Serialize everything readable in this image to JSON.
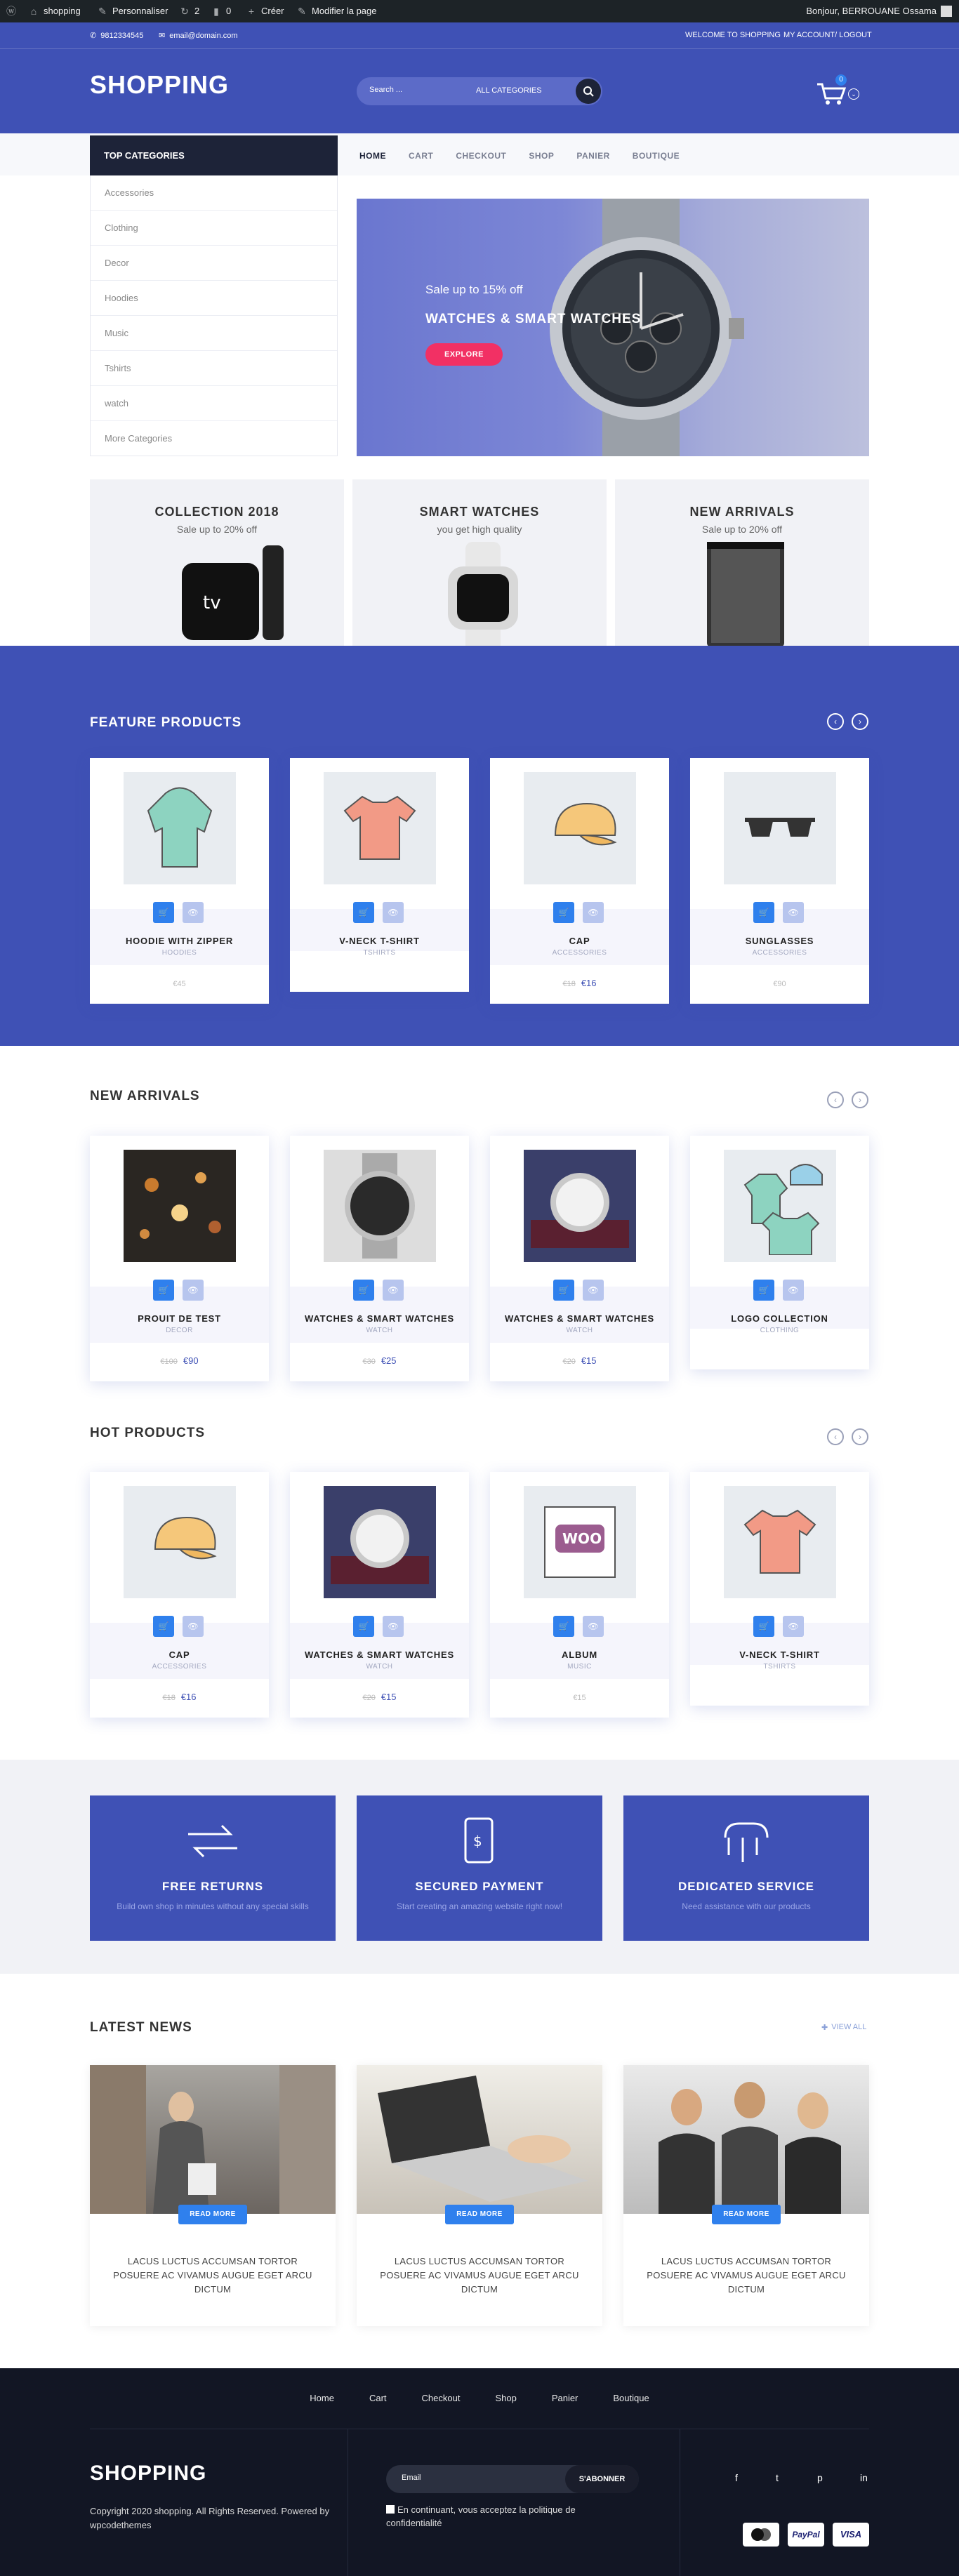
{
  "adminbar": {
    "site": "shopping",
    "customize": "Personnaliser",
    "updates": "2",
    "comments": "0",
    "new": "Créer",
    "edit": "Modifier la page",
    "greeting": "Bonjour, BERROUANE Ossama"
  },
  "topbar": {
    "phone": "9812334545",
    "email": "email@domain.com",
    "welcome": "WELCOME TO SHOPPING",
    "account": "MY ACCOUNT/ LOGOUT"
  },
  "header": {
    "logo": "SHOPPING",
    "search_placeholder": "Search ...",
    "category": "ALL CATEGORIES",
    "cart_count": "0"
  },
  "sidebar": {
    "title": "TOP CATEGORIES",
    "items": [
      "Accessories",
      "Clothing",
      "Decor",
      "Hoodies",
      "Music",
      "Tshirts",
      "watch",
      "More Categories"
    ]
  },
  "menu": [
    "HOME",
    "CART",
    "CHECKOUT",
    "SHOP",
    "PANIER",
    "BOUTIQUE"
  ],
  "hero": {
    "subtitle": "Sale up to 15% off",
    "title": "WATCHES & SMART WATCHES",
    "button": "EXPLORE"
  },
  "promos": [
    {
      "title": "COLLECTION 2018",
      "sub": "Sale up to 20% off"
    },
    {
      "title": "SMART WATCHES",
      "sub": "you get high quality"
    },
    {
      "title": "NEW ARRIVALS",
      "sub": "Sale up to 20% off"
    }
  ],
  "feature": {
    "title": "FEATURE PRODUCTS",
    "items": [
      {
        "name": "HOODIE WITH ZIPPER",
        "cat": "HOODIES",
        "old": "",
        "price": "€45",
        "icon": "hoodie-image"
      },
      {
        "name": "V-NECK T-SHIRT",
        "cat": "TSHIRTS",
        "old": "",
        "price": "",
        "icon": "tshirt-image"
      },
      {
        "name": "CAP",
        "cat": "ACCESSORIES",
        "old": "€18",
        "price": "€16",
        "icon": "cap-image"
      },
      {
        "name": "SUNGLASSES",
        "cat": "ACCESSORIES",
        "old": "",
        "price": "€90",
        "icon": "sunglasses-image"
      }
    ]
  },
  "arrivals": {
    "title": "NEW ARRIVALS",
    "items": [
      {
        "name": "PROUIT DE TEST",
        "cat": "DECOR",
        "old": "€100",
        "price": "€90"
      },
      {
        "name": "WATCHES & SMART WATCHES",
        "cat": "WATCH",
        "old": "€30",
        "price": "€25"
      },
      {
        "name": "WATCHES & SMART WATCHES",
        "cat": "WATCH",
        "old": "€20",
        "price": "€15"
      },
      {
        "name": "LOGO COLLECTION",
        "cat": "CLOTHING",
        "old": "",
        "price": ""
      }
    ]
  },
  "hot": {
    "title": "HOT PRODUCTS",
    "items": [
      {
        "name": "CAP",
        "cat": "ACCESSORIES",
        "old": "€18",
        "price": "€16"
      },
      {
        "name": "WATCHES & SMART WATCHES",
        "cat": "WATCH",
        "old": "€20",
        "price": "€15"
      },
      {
        "name": "ALBUM",
        "cat": "MUSIC",
        "old": "",
        "price": "€15"
      },
      {
        "name": "V-NECK T-SHIRT",
        "cat": "TSHIRTS",
        "old": "",
        "price": ""
      }
    ]
  },
  "services": [
    {
      "title": "FREE RETURNS",
      "desc": "Build own shop in minutes without any special skills"
    },
    {
      "title": "SECURED PAYMENT",
      "desc": "Start creating an amazing website right now!"
    },
    {
      "title": "DEDICATED SERVICE",
      "desc": "Need assistance with our products"
    }
  ],
  "news": {
    "title": "LATEST NEWS",
    "view_all": "VIEW ALL",
    "read_more": "READ MORE",
    "items": [
      {
        "title": "LACUS LUCTUS ACCUMSAN TORTOR POSUERE AC VIVAMUS AUGUE EGET ARCU DICTUM"
      },
      {
        "title": "LACUS LUCTUS ACCUMSAN TORTOR POSUERE AC VIVAMUS AUGUE EGET ARCU DICTUM"
      },
      {
        "title": "LACUS LUCTUS ACCUMSAN TORTOR POSUERE AC VIVAMUS AUGUE EGET ARCU DICTUM"
      }
    ]
  },
  "footer": {
    "nav": [
      "Home",
      "Cart",
      "Checkout",
      "Shop",
      "Panier",
      "Boutique"
    ],
    "logo": "SHOPPING",
    "copyright": "Copyright 2020 shopping. All Rights Reserved. Powered by",
    "powered": "wpcodethemes",
    "email_placeholder": "Email",
    "subscribe": "S'ABONNER",
    "consent": "En continuant, vous acceptez la politique de confidentialité",
    "payments": [
      "mastercard",
      "PayPal",
      "VISA"
    ]
  }
}
